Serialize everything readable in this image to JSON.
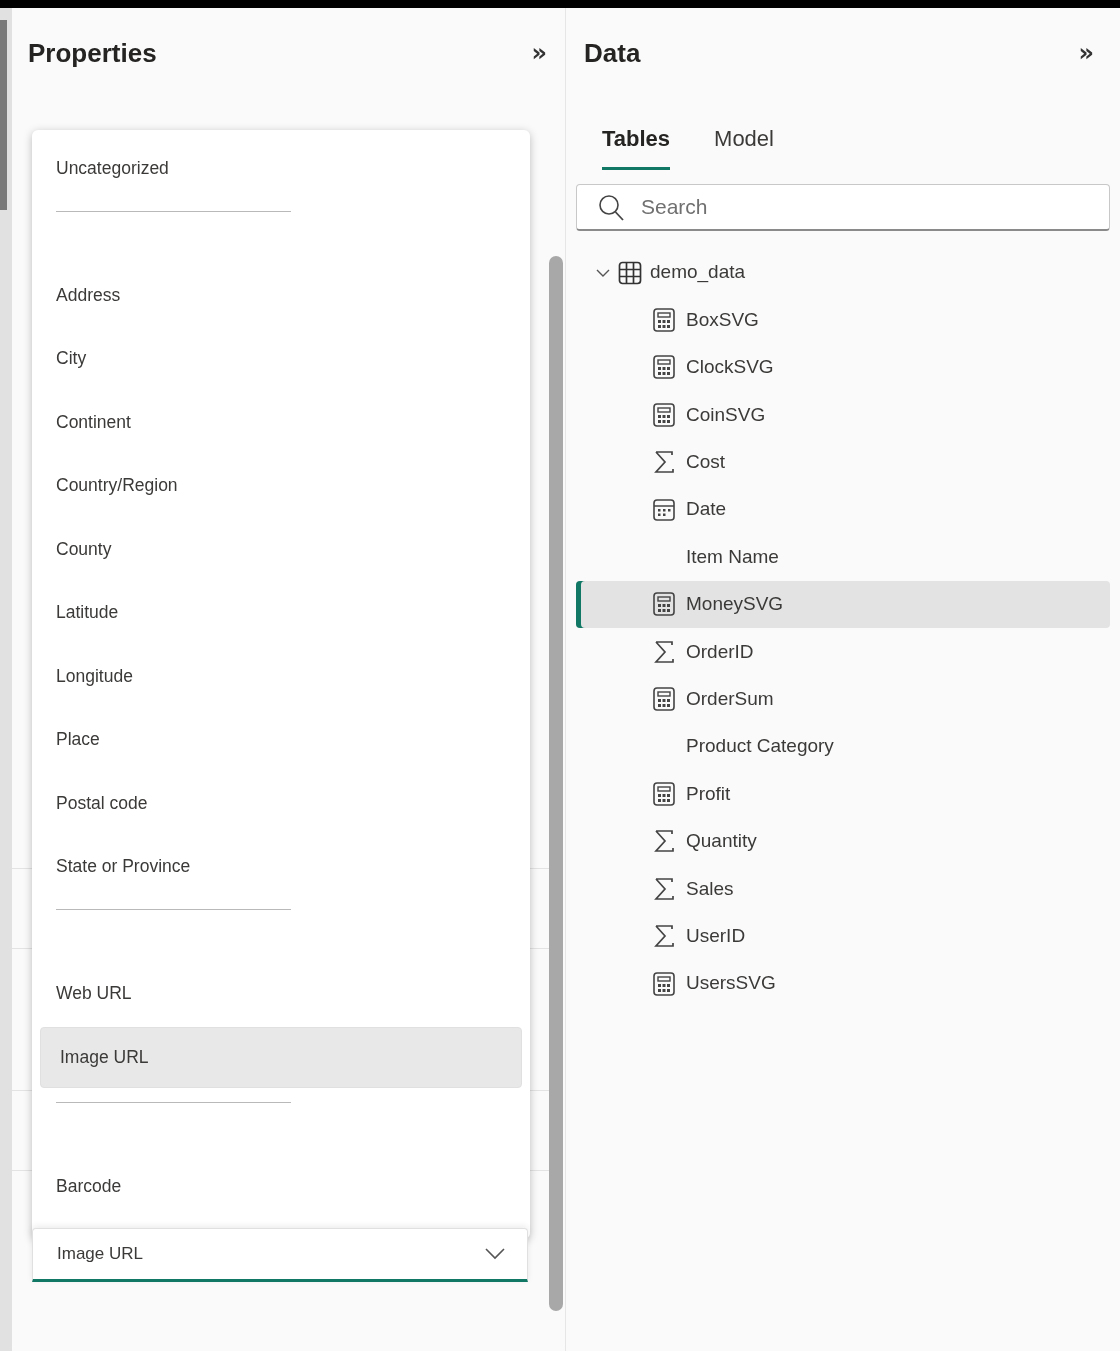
{
  "properties_panel": {
    "title": "Properties",
    "collapse_icon": "»",
    "menu": [
      {
        "kind": "option",
        "label": "Uncategorized",
        "selected": false
      },
      {
        "kind": "divider"
      },
      {
        "kind": "option",
        "label": "Address",
        "selected": false
      },
      {
        "kind": "option",
        "label": "City",
        "selected": false
      },
      {
        "kind": "option",
        "label": "Continent",
        "selected": false
      },
      {
        "kind": "option",
        "label": "Country/Region",
        "selected": false
      },
      {
        "kind": "option",
        "label": "County",
        "selected": false
      },
      {
        "kind": "option",
        "label": "Latitude",
        "selected": false
      },
      {
        "kind": "option",
        "label": "Longitude",
        "selected": false
      },
      {
        "kind": "option",
        "label": "Place",
        "selected": false
      },
      {
        "kind": "option",
        "label": "Postal code",
        "selected": false
      },
      {
        "kind": "option",
        "label": "State or Province",
        "selected": false
      },
      {
        "kind": "divider"
      },
      {
        "kind": "option",
        "label": "Web URL",
        "selected": false
      },
      {
        "kind": "option",
        "label": "Image URL",
        "selected": true
      },
      {
        "kind": "divider"
      },
      {
        "kind": "option",
        "label": "Barcode",
        "selected": false
      }
    ],
    "category_select": {
      "value": "Image URL"
    }
  },
  "data_panel": {
    "title": "Data",
    "collapse_icon": "»",
    "tabs": [
      {
        "label": "Tables",
        "selected": true
      },
      {
        "label": "Model",
        "selected": false
      }
    ],
    "search": {
      "placeholder": "Search"
    },
    "tree": [
      {
        "label": "demo_data",
        "expanded": true,
        "children": [
          {
            "label": "BoxSVG",
            "kind": "measure",
            "selected": false
          },
          {
            "label": "ClockSVG",
            "kind": "measure",
            "selected": false
          },
          {
            "label": "CoinSVG",
            "kind": "measure",
            "selected": false
          },
          {
            "label": "Cost",
            "kind": "sum",
            "selected": false
          },
          {
            "label": "Date",
            "kind": "date",
            "selected": false
          },
          {
            "label": "Item Name",
            "kind": "text",
            "selected": false
          },
          {
            "label": "MoneySVG",
            "kind": "measure",
            "selected": true
          },
          {
            "label": "OrderID",
            "kind": "sum",
            "selected": false
          },
          {
            "label": "OrderSum",
            "kind": "measure",
            "selected": false
          },
          {
            "label": "Product Category",
            "kind": "text",
            "selected": false
          },
          {
            "label": "Profit",
            "kind": "measure",
            "selected": false
          },
          {
            "label": "Quantity",
            "kind": "sum",
            "selected": false
          },
          {
            "label": "Sales",
            "kind": "sum",
            "selected": false
          },
          {
            "label": "UserID",
            "kind": "sum",
            "selected": false
          },
          {
            "label": "UsersSVG",
            "kind": "measure",
            "selected": false
          }
        ]
      }
    ]
  }
}
